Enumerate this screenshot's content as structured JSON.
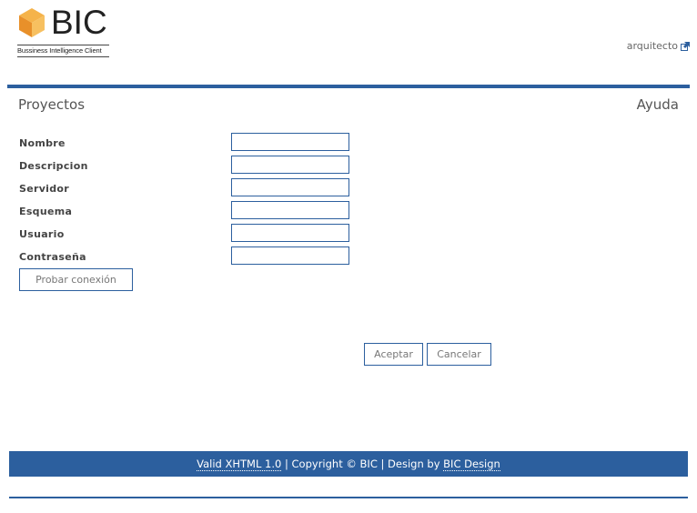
{
  "header": {
    "logo_text": "BIC",
    "logo_tagline": "Bussiness Intelligence Client",
    "user_link": "arquitecto",
    "user_link_icon": "external-link-icon"
  },
  "page": {
    "title": "Proyectos",
    "help": "Ayuda"
  },
  "form": {
    "fields": [
      {
        "label": "Nombre",
        "value": ""
      },
      {
        "label": "Descripcion",
        "value": ""
      },
      {
        "label": "Servidor",
        "value": ""
      },
      {
        "label": "Esquema",
        "value": ""
      },
      {
        "label": "Usuario",
        "value": ""
      },
      {
        "label": "Contraseña",
        "value": ""
      }
    ],
    "test_button": "Probar conexión",
    "accept_button": "Aceptar",
    "cancel_button": "Cancelar"
  },
  "footer": {
    "valid_link": "Valid XHTML 1.0",
    "sep1": " | ",
    "copyright": "Copyright © BIC",
    "sep2": " | ",
    "design_prefix": "Design by ",
    "design_link": "BIC Design"
  },
  "colors": {
    "accent": "#2c5f9e",
    "logo_orange": "#f0a030"
  }
}
